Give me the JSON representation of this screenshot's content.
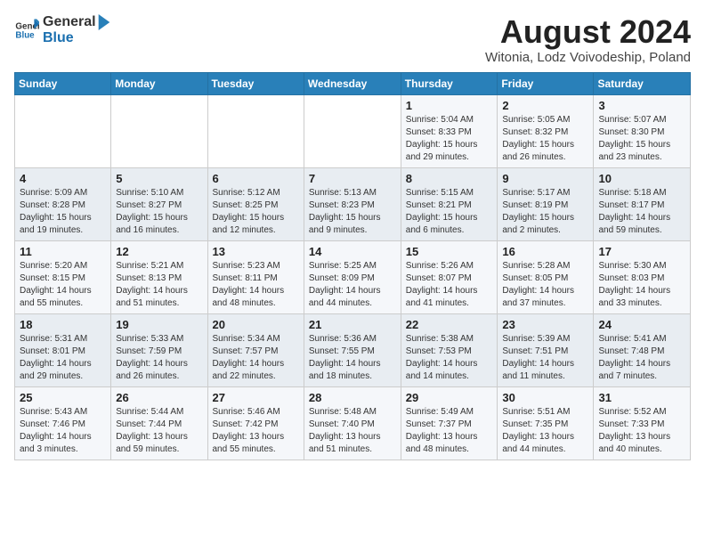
{
  "header": {
    "logo_general": "General",
    "logo_blue": "Blue",
    "month_year": "August 2024",
    "location": "Witonia, Lodz Voivodeship, Poland"
  },
  "weekdays": [
    "Sunday",
    "Monday",
    "Tuesday",
    "Wednesday",
    "Thursday",
    "Friday",
    "Saturday"
  ],
  "weeks": [
    [
      {
        "day": "",
        "content": ""
      },
      {
        "day": "",
        "content": ""
      },
      {
        "day": "",
        "content": ""
      },
      {
        "day": "",
        "content": ""
      },
      {
        "day": "1",
        "content": "Sunrise: 5:04 AM\nSunset: 8:33 PM\nDaylight: 15 hours\nand 29 minutes."
      },
      {
        "day": "2",
        "content": "Sunrise: 5:05 AM\nSunset: 8:32 PM\nDaylight: 15 hours\nand 26 minutes."
      },
      {
        "day": "3",
        "content": "Sunrise: 5:07 AM\nSunset: 8:30 PM\nDaylight: 15 hours\nand 23 minutes."
      }
    ],
    [
      {
        "day": "4",
        "content": "Sunrise: 5:09 AM\nSunset: 8:28 PM\nDaylight: 15 hours\nand 19 minutes."
      },
      {
        "day": "5",
        "content": "Sunrise: 5:10 AM\nSunset: 8:27 PM\nDaylight: 15 hours\nand 16 minutes."
      },
      {
        "day": "6",
        "content": "Sunrise: 5:12 AM\nSunset: 8:25 PM\nDaylight: 15 hours\nand 12 minutes."
      },
      {
        "day": "7",
        "content": "Sunrise: 5:13 AM\nSunset: 8:23 PM\nDaylight: 15 hours\nand 9 minutes."
      },
      {
        "day": "8",
        "content": "Sunrise: 5:15 AM\nSunset: 8:21 PM\nDaylight: 15 hours\nand 6 minutes."
      },
      {
        "day": "9",
        "content": "Sunrise: 5:17 AM\nSunset: 8:19 PM\nDaylight: 15 hours\nand 2 minutes."
      },
      {
        "day": "10",
        "content": "Sunrise: 5:18 AM\nSunset: 8:17 PM\nDaylight: 14 hours\nand 59 minutes."
      }
    ],
    [
      {
        "day": "11",
        "content": "Sunrise: 5:20 AM\nSunset: 8:15 PM\nDaylight: 14 hours\nand 55 minutes."
      },
      {
        "day": "12",
        "content": "Sunrise: 5:21 AM\nSunset: 8:13 PM\nDaylight: 14 hours\nand 51 minutes."
      },
      {
        "day": "13",
        "content": "Sunrise: 5:23 AM\nSunset: 8:11 PM\nDaylight: 14 hours\nand 48 minutes."
      },
      {
        "day": "14",
        "content": "Sunrise: 5:25 AM\nSunset: 8:09 PM\nDaylight: 14 hours\nand 44 minutes."
      },
      {
        "day": "15",
        "content": "Sunrise: 5:26 AM\nSunset: 8:07 PM\nDaylight: 14 hours\nand 41 minutes."
      },
      {
        "day": "16",
        "content": "Sunrise: 5:28 AM\nSunset: 8:05 PM\nDaylight: 14 hours\nand 37 minutes."
      },
      {
        "day": "17",
        "content": "Sunrise: 5:30 AM\nSunset: 8:03 PM\nDaylight: 14 hours\nand 33 minutes."
      }
    ],
    [
      {
        "day": "18",
        "content": "Sunrise: 5:31 AM\nSunset: 8:01 PM\nDaylight: 14 hours\nand 29 minutes."
      },
      {
        "day": "19",
        "content": "Sunrise: 5:33 AM\nSunset: 7:59 PM\nDaylight: 14 hours\nand 26 minutes."
      },
      {
        "day": "20",
        "content": "Sunrise: 5:34 AM\nSunset: 7:57 PM\nDaylight: 14 hours\nand 22 minutes."
      },
      {
        "day": "21",
        "content": "Sunrise: 5:36 AM\nSunset: 7:55 PM\nDaylight: 14 hours\nand 18 minutes."
      },
      {
        "day": "22",
        "content": "Sunrise: 5:38 AM\nSunset: 7:53 PM\nDaylight: 14 hours\nand 14 minutes."
      },
      {
        "day": "23",
        "content": "Sunrise: 5:39 AM\nSunset: 7:51 PM\nDaylight: 14 hours\nand 11 minutes."
      },
      {
        "day": "24",
        "content": "Sunrise: 5:41 AM\nSunset: 7:48 PM\nDaylight: 14 hours\nand 7 minutes."
      }
    ],
    [
      {
        "day": "25",
        "content": "Sunrise: 5:43 AM\nSunset: 7:46 PM\nDaylight: 14 hours\nand 3 minutes."
      },
      {
        "day": "26",
        "content": "Sunrise: 5:44 AM\nSunset: 7:44 PM\nDaylight: 13 hours\nand 59 minutes."
      },
      {
        "day": "27",
        "content": "Sunrise: 5:46 AM\nSunset: 7:42 PM\nDaylight: 13 hours\nand 55 minutes."
      },
      {
        "day": "28",
        "content": "Sunrise: 5:48 AM\nSunset: 7:40 PM\nDaylight: 13 hours\nand 51 minutes."
      },
      {
        "day": "29",
        "content": "Sunrise: 5:49 AM\nSunset: 7:37 PM\nDaylight: 13 hours\nand 48 minutes."
      },
      {
        "day": "30",
        "content": "Sunrise: 5:51 AM\nSunset: 7:35 PM\nDaylight: 13 hours\nand 44 minutes."
      },
      {
        "day": "31",
        "content": "Sunrise: 5:52 AM\nSunset: 7:33 PM\nDaylight: 13 hours\nand 40 minutes."
      }
    ]
  ]
}
